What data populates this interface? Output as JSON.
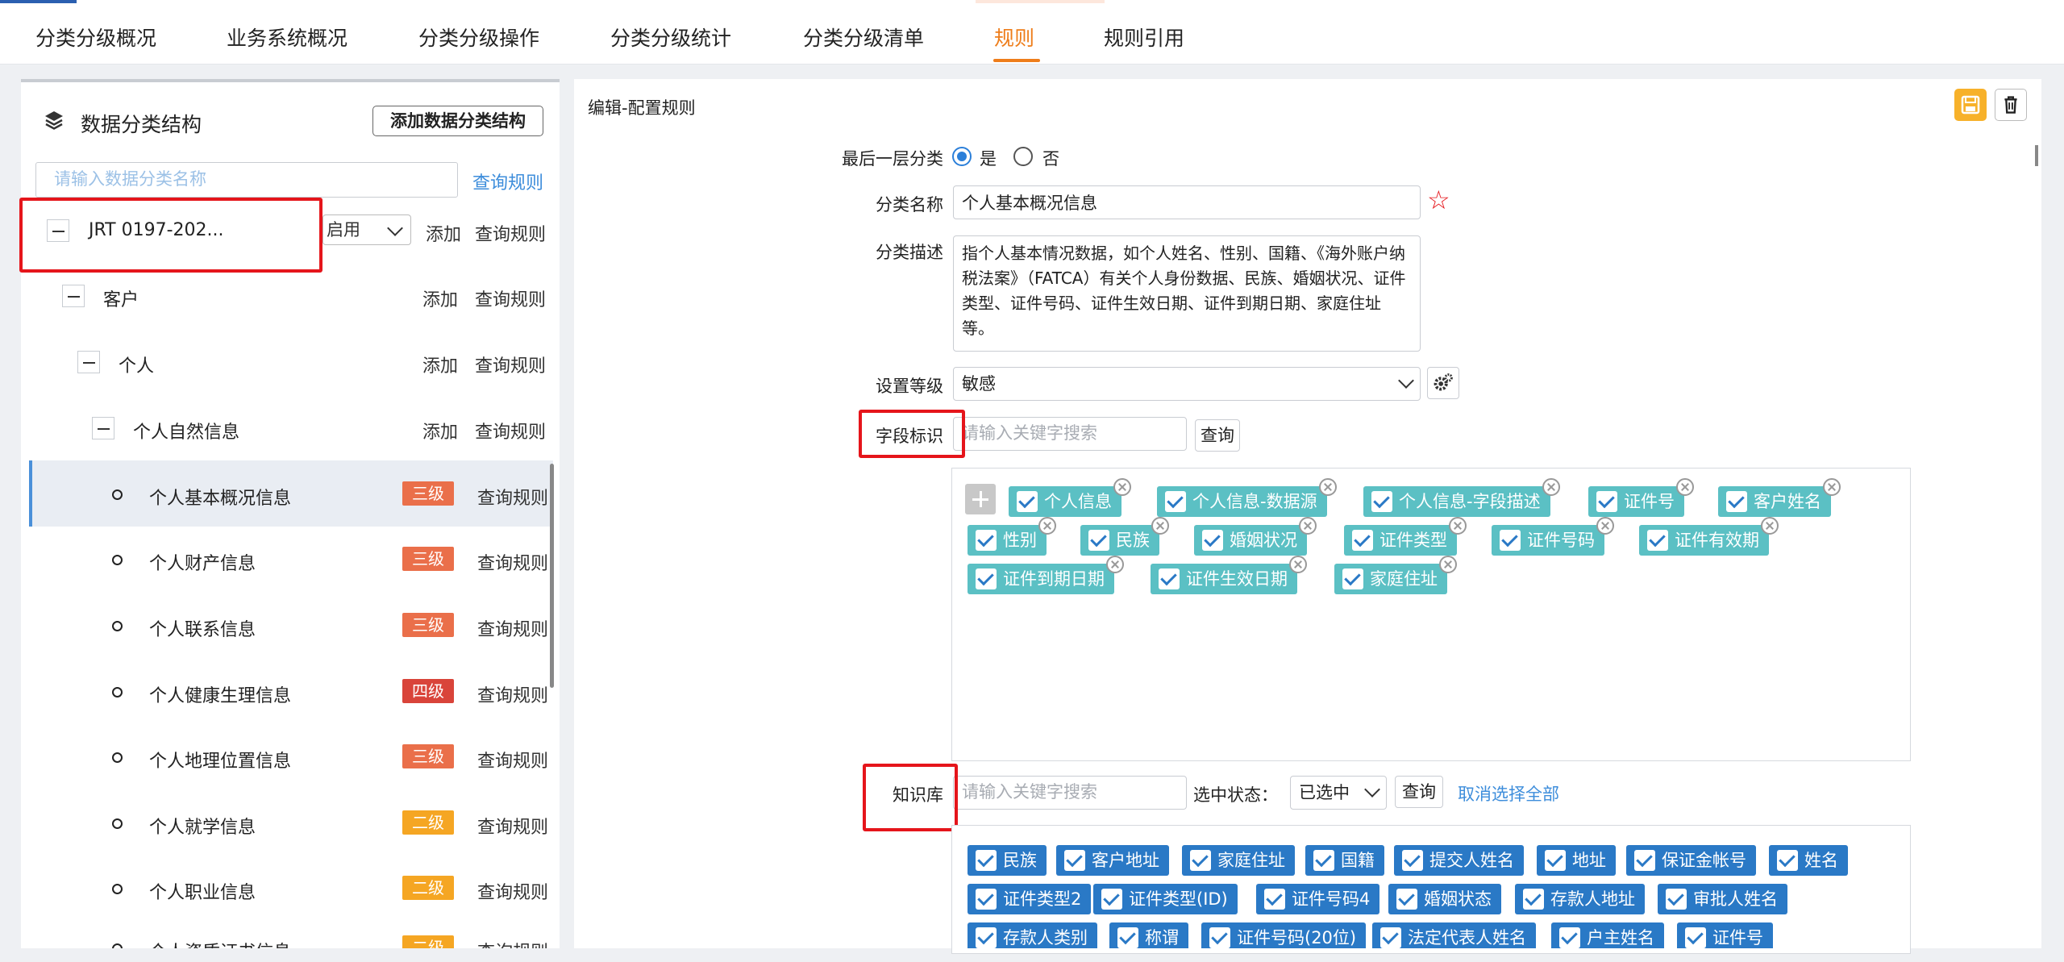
{
  "tabs": [
    "分类分级概况",
    "业务系统概况",
    "分类分级操作",
    "分类分级统计",
    "分类分级清单",
    "规则",
    "规则引用"
  ],
  "left": {
    "title": "数据分类结构",
    "add_struct_button": "添加数据分类结构",
    "search_placeholder": "请输入数据分类名称",
    "query_rule_link": "查询规则",
    "root": {
      "label": "JRT 0197-202...",
      "status": "启用",
      "add": "添加",
      "query": "查询规则"
    },
    "nodes": [
      {
        "label": "客户",
        "add": "添加",
        "query": "查询规则"
      },
      {
        "label": "个人",
        "add": "添加",
        "query": "查询规则"
      },
      {
        "label": "个人自然信息",
        "add": "添加",
        "query": "查询规则"
      }
    ],
    "leaves": [
      {
        "label": "个人基本概况信息",
        "level": "三级",
        "query": "查询规则"
      },
      {
        "label": "个人财产信息",
        "level": "三级",
        "query": "查询规则"
      },
      {
        "label": "个人联系信息",
        "level": "三级",
        "query": "查询规则"
      },
      {
        "label": "个人健康生理信息",
        "level": "四级",
        "query": "查询规则"
      },
      {
        "label": "个人地理位置信息",
        "level": "三级",
        "query": "查询规则"
      },
      {
        "label": "个人就学信息",
        "level": "二级",
        "query": "查询规则"
      },
      {
        "label": "个人职业信息",
        "level": "二级",
        "query": "查询规则"
      },
      {
        "label": "个人资质证书信息",
        "level": "二级",
        "query": "查询规则"
      }
    ]
  },
  "right": {
    "title": "编辑-配置规则",
    "last_layer_label": "最后一层分类",
    "yes": "是",
    "no": "否",
    "name_label": "分类名称",
    "name_value": "个人基本概况信息",
    "desc_label": "分类描述",
    "desc_value": "指个人基本情况数据，如个人姓名、性别、国籍、《海外账户纳税法案》（FATCA）有关个人身份数据、民族、婚姻状况、证件类型、证件号码、证件生效日期、证件到期日期、家庭住址等。",
    "level_label": "设置等级",
    "level_value": "敏感",
    "field_label": "字段标识",
    "field_placeholder": "请输入关键字搜索",
    "query_button": "查询",
    "field_tags": [
      [
        "个人信息",
        "个人信息-数据源",
        "个人信息-字段描述",
        "证件号",
        "客户姓名"
      ],
      [
        "性别",
        "民族",
        "婚姻状况",
        "证件类型",
        "证件号码",
        "证件有效期"
      ],
      [
        "证件到期日期",
        "证件生效日期",
        "家庭住址"
      ]
    ],
    "kb_label": "知识库",
    "kb_placeholder": "请输入关键字搜索",
    "select_state_label": "选中状态：",
    "select_state_value": "已选中",
    "kb_query_button": "查询",
    "cancel_all_link": "取消选择全部",
    "kb_tags": [
      [
        "民族",
        "客户地址",
        "家庭住址",
        "国籍",
        "提交人姓名",
        "地址",
        "保证金帐号",
        "姓名"
      ],
      [
        "证件类型2",
        "证件类型(ID)",
        "证件号码4",
        "婚姻状态",
        "存款人地址",
        "审批人姓名"
      ],
      [
        "存款人类别",
        "称谓",
        "证件号码(20位)",
        "法定代表人姓名",
        "户主姓名",
        "证件号"
      ]
    ]
  },
  "colors": {
    "accent": "#ee7d1a",
    "level3": "#ea6f4a",
    "level4": "#d9443a",
    "level2": "#f5a623",
    "tag_teal": "#5bc0c4",
    "tag_blue": "#2a79c6",
    "highlight": "#e5151b"
  }
}
